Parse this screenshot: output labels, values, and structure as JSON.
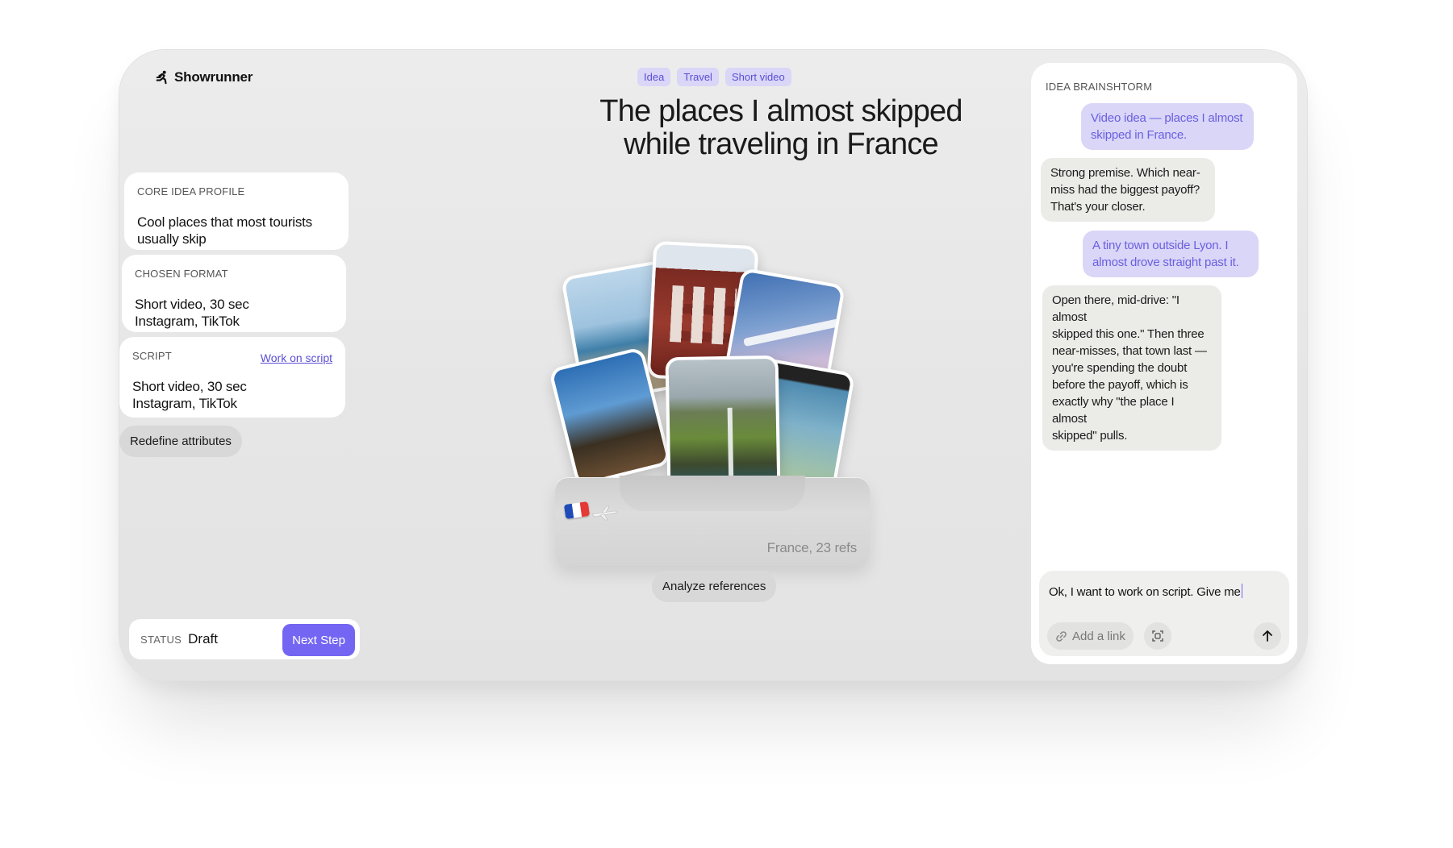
{
  "app": {
    "name": "Showrunner"
  },
  "header": {
    "tags": [
      "Idea",
      "Travel",
      "Short video"
    ],
    "title_line1": "The places I almost skipped",
    "title_line2": "while traveling in France"
  },
  "left": {
    "core_idea": {
      "label": "CORE IDEA PROFILE",
      "value_line1": "Cool places that most tourists",
      "value_line2": "usually skip"
    },
    "format": {
      "label": "CHOSEN FORMAT",
      "value_line1": "Short video, 30 sec",
      "value_line2": "Instagram, TikTok"
    },
    "script": {
      "label": "SCRIPT",
      "link": "Work on script",
      "value_line1": "Short video, 30 sec",
      "value_line2": "Instagram, TikTok"
    },
    "redefine_label": "Redefine attributes",
    "status": {
      "label": "STATUS",
      "value": "Draft",
      "next_label": "Next Step"
    }
  },
  "references": {
    "tray_label": "France, 23 refs",
    "analyze_label": "Analyze references",
    "colors": {
      "flag_blue": "#1f4bb8",
      "flag_white": "#ffffff",
      "flag_red": "#e53935"
    }
  },
  "chat": {
    "title": "IDEA BRAINSHTORM",
    "messages": [
      {
        "role": "user",
        "lines": [
          "Video idea — places I almost",
          "skipped in France."
        ]
      },
      {
        "role": "bot",
        "lines": [
          "Strong premise. Which near-",
          "miss had the biggest payoff?",
          "That's your closer."
        ]
      },
      {
        "role": "user",
        "lines": [
          "A tiny town outside Lyon. I",
          "almost drove straight past it."
        ]
      },
      {
        "role": "bot",
        "lines": [
          "Open there, mid-drive: \"I almost",
          "skipped this one.\" Then three",
          "near-misses, that town last —",
          "you're spending the doubt",
          "before the payoff, which is",
          "exactly why \"the place I almost",
          "skipped\" pulls."
        ]
      }
    ],
    "composer": {
      "value": "Ok, I want to work on script. Give me",
      "add_link_label": "Add a link",
      "icons": {
        "link": "link-icon",
        "scan": "scan-icon",
        "send": "arrow-up-icon"
      }
    }
  },
  "theme": {
    "accent": "#7466f2",
    "tag_bg": "#d9d6f7",
    "tag_text": "#5a4fd6"
  }
}
